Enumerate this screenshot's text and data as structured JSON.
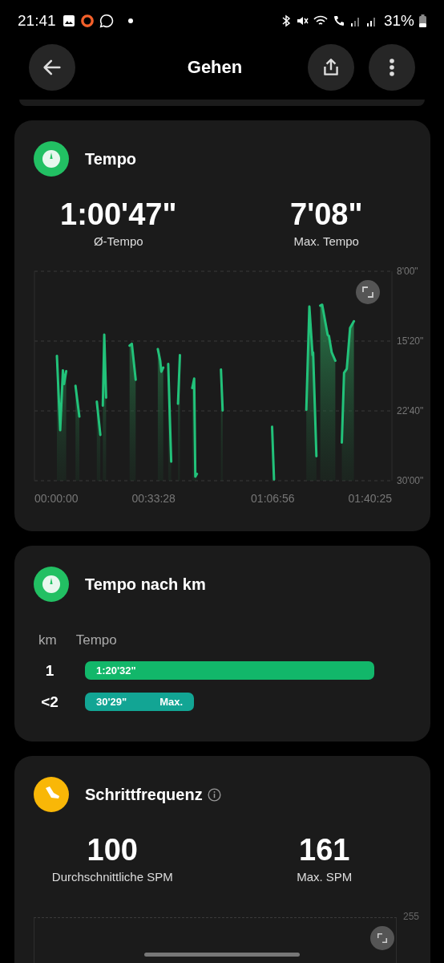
{
  "status_bar": {
    "time": "21:41",
    "battery": "31%"
  },
  "header": {
    "title": "Gehen"
  },
  "pace_card": {
    "title": "Tempo",
    "stats": [
      {
        "value": "1:00'47\"",
        "label": "Ø-Tempo"
      },
      {
        "value": "7'08\"",
        "label": "Max. Tempo"
      }
    ],
    "chart": {
      "y_labels": [
        "8'00\"",
        "15'20\"",
        "22'40\"",
        "30'00\""
      ],
      "x_labels": [
        "00:00:00",
        "00:33:28",
        "01:06:56",
        "01:40:25"
      ]
    }
  },
  "km_card": {
    "title": "Tempo nach km",
    "columns": [
      "km",
      "Tempo"
    ],
    "rows": [
      {
        "km": "1",
        "pace": "1:20'32\"",
        "color": "#12b76a"
      },
      {
        "km": "<2",
        "pace": "30'29\"",
        "badge": "Max.",
        "color": "#12a594"
      }
    ]
  },
  "cadence_card": {
    "title": "Schrittfrequenz",
    "stats": [
      {
        "value": "100",
        "label": "Durchschnittliche SPM"
      },
      {
        "value": "161",
        "label": "Max. SPM"
      }
    ],
    "y_tick": "255"
  }
}
